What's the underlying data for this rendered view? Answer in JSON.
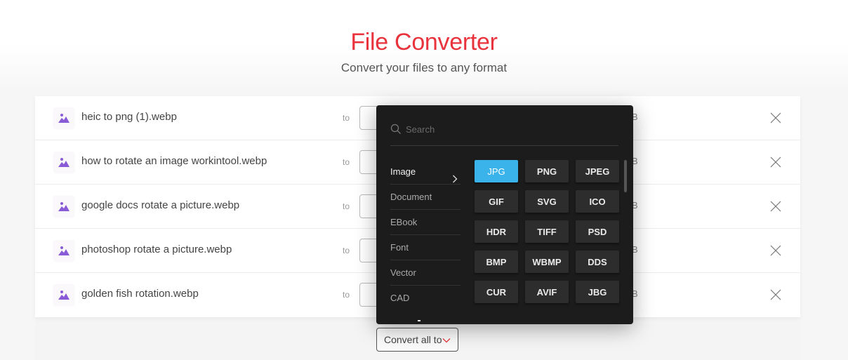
{
  "header": {
    "title": "File Converter",
    "subtitle": "Convert your files to any format"
  },
  "files": [
    {
      "name": "heic to png (1).webp",
      "to_label": "to",
      "size_suffix": "B",
      "icon": "image-icon"
    },
    {
      "name": "how to rotate an image workintool.webp",
      "to_label": "to",
      "size_suffix": "B",
      "icon": "image-icon"
    },
    {
      "name": "google docs rotate a picture.webp",
      "to_label": "to",
      "size_suffix": "B",
      "icon": "image-icon"
    },
    {
      "name": "photoshop rotate a picture.webp",
      "to_label": "to",
      "size_suffix": "B",
      "icon": "image-icon"
    },
    {
      "name": "golden fish rotation.webp",
      "to_label": "to",
      "size_suffix": "B",
      "icon": "image-icon"
    }
  ],
  "dropdown": {
    "search_placeholder": "Search",
    "search_value": "",
    "categories": [
      {
        "label": "Image",
        "active": true
      },
      {
        "label": "Document",
        "active": false
      },
      {
        "label": "EBook",
        "active": false
      },
      {
        "label": "Font",
        "active": false
      },
      {
        "label": "Vector",
        "active": false
      },
      {
        "label": "CAD",
        "active": false
      }
    ],
    "formats": [
      "JPG",
      "PNG",
      "JPEG",
      "GIF",
      "SVG",
      "ICO",
      "HDR",
      "TIFF",
      "PSD",
      "BMP",
      "WBMP",
      "DDS",
      "CUR",
      "AVIF",
      "JBG"
    ],
    "selected_format": "JPG"
  },
  "convert_all": {
    "label": "Convert all to"
  },
  "colors": {
    "title": "#e8333c",
    "accent_selected": "#3ab2ea",
    "file_icon": "#8a5bd6",
    "dropdown_bg": "#1c1c1c"
  }
}
